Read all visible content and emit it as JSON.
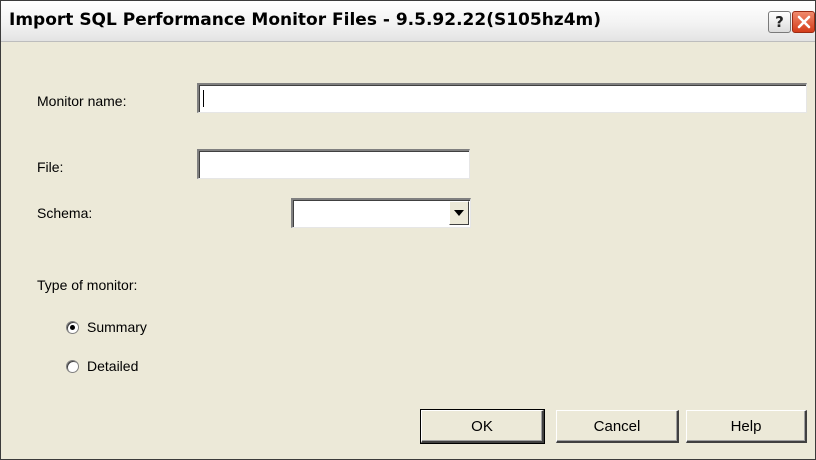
{
  "window": {
    "title": "Import SQL Performance Monitor Files - 9.5.92.22(S105hz4m)",
    "help_glyph": "?"
  },
  "form": {
    "monitor_name": {
      "label": "Monitor name:",
      "value": ""
    },
    "file": {
      "label": "File:",
      "value": ""
    },
    "schema": {
      "label": "Schema:",
      "value": ""
    },
    "type_of_monitor": {
      "label": "Type of monitor:",
      "options": [
        {
          "label": "Summary",
          "selected": true
        },
        {
          "label": "Detailed",
          "selected": false
        }
      ]
    }
  },
  "buttons": {
    "ok": "OK",
    "cancel": "Cancel",
    "help": "Help"
  },
  "colors": {
    "dialog_background": "#ece9d8",
    "close_button": "#d43c1a"
  },
  "icons": {
    "help_button": "question-mark-icon",
    "close_button": "close-x-icon",
    "schema_dropdown": "chevron-down-icon"
  }
}
